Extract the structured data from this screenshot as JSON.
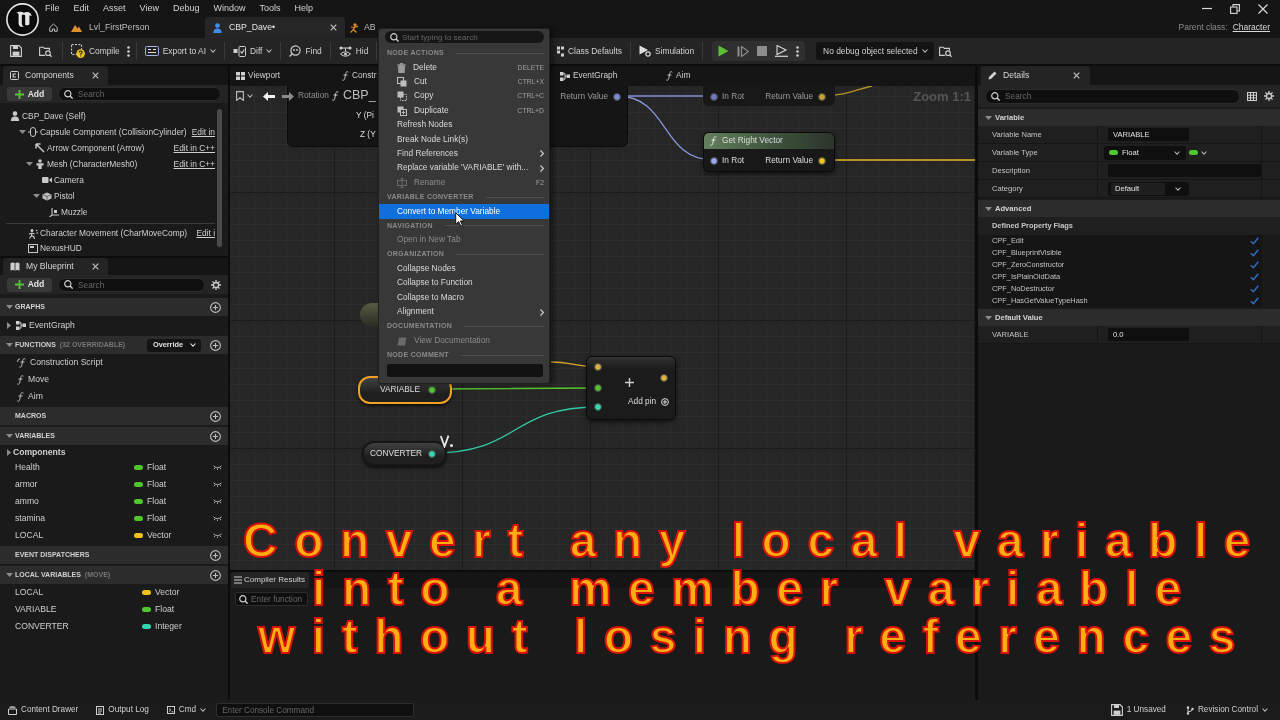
{
  "title_bar": {
    "menu": [
      "File",
      "Edit",
      "Asset",
      "View",
      "Debug",
      "Window",
      "Tools",
      "Help"
    ],
    "tabs": [
      {
        "label": "Lvl_FirstPerson",
        "kind": "level",
        "selected": false
      },
      {
        "label": "CBP_Dave•",
        "kind": "blueprint",
        "selected": true
      },
      {
        "label": "AB",
        "kind": "animation",
        "selected": false
      }
    ],
    "parent_class_label": "Parent class:",
    "parent_class": "Character"
  },
  "toolbar": {
    "items": [
      {
        "kind": "compile",
        "label": "Compile",
        "dropdown": false
      },
      {
        "kind": "export",
        "label": "Export to AI",
        "dropdown": true
      },
      {
        "kind": "diff",
        "label": "Diff",
        "dropdown": true
      },
      {
        "kind": "find",
        "label": "Find",
        "dropdown": false
      },
      {
        "kind": "hide",
        "label": "Hid",
        "dropdown": false
      },
      {
        "kind": "class_defaults",
        "label": "Class Defaults",
        "dropdown": false
      },
      {
        "kind": "simulation",
        "label": "Simulation",
        "dropdown": false
      }
    ],
    "debug_object": "No debug object selected"
  },
  "components_panel": {
    "title": "Components",
    "add": "Add",
    "search_placeholder": "Search",
    "tree": [
      {
        "label": "CBP_Dave (Self)",
        "kind": "self",
        "children": [
          {
            "label": "Capsule Component (CollisionCylinder)",
            "kind": "capsule",
            "edit_link": "Edit in",
            "expanded": true,
            "children": [
              {
                "label": "Arrow Component (Arrow)",
                "kind": "arrow",
                "edit_link": "Edit in C++"
              },
              {
                "label": "Mesh (CharacterMesh0)",
                "kind": "mesh",
                "edit_link": "Edit in C++",
                "expanded": true,
                "children": [
                  {
                    "label": "Camera",
                    "kind": "camera"
                  },
                  {
                    "label": "Pistol",
                    "kind": "static_mesh",
                    "expanded": true,
                    "children": [
                      {
                        "label": "Muzzle",
                        "kind": "scene"
                      }
                    ]
                  }
                ]
              }
            ]
          }
        ]
      }
    ],
    "other_components": [
      {
        "label": "Character Movement (CharMoveComp)",
        "kind": "movement",
        "edit_link": "Edit i"
      },
      {
        "label": "NexusHUD",
        "kind": "widget"
      }
    ]
  },
  "my_blueprint": {
    "title": "My Blueprint",
    "add": "Add",
    "search_placeholder": "Search",
    "sections": [
      {
        "heading": "GRAPHS",
        "expanded": true,
        "items": [
          {
            "label": "EventGraph",
            "kind": "graph",
            "expanded": false
          }
        ]
      },
      {
        "heading": "FUNCTIONS",
        "note": "(32 OVERRIDABLE)",
        "override": "Override",
        "expanded": true,
        "items": [
          {
            "label": "Construction Script",
            "kind": "construction"
          },
          {
            "label": "Move",
            "kind": "function"
          },
          {
            "label": "Aim",
            "kind": "function"
          }
        ]
      },
      {
        "heading": "MACROS"
      },
      {
        "heading": "VARIABLES",
        "expanded": true,
        "items": [
          {
            "label": "Components",
            "kind": "category",
            "expanded": false
          },
          {
            "label": "Health",
            "kind": "variable",
            "type": "Float",
            "color": "#52c62e",
            "public": false
          },
          {
            "label": "armor",
            "kind": "variable",
            "type": "Float",
            "color": "#52c62e",
            "public": false
          },
          {
            "label": "ammo",
            "kind": "variable",
            "type": "Float",
            "color": "#52c62e",
            "public": false
          },
          {
            "label": "stamina",
            "kind": "variable",
            "type": "Float",
            "color": "#52c62e",
            "public": false
          },
          {
            "label": "LOCAL",
            "kind": "variable",
            "type": "Vector",
            "color": "#f2c21b",
            "public": false
          }
        ]
      },
      {
        "heading": "EVENT DISPATCHERS"
      },
      {
        "heading": "LOCAL VARIABLES",
        "note": "(MOVE)",
        "expanded": true,
        "items": [
          {
            "label": "LOCAL",
            "kind": "local",
            "type": "Vector",
            "color": "#f2c21b"
          },
          {
            "label": "VARIABLE",
            "kind": "local",
            "type": "Float",
            "color": "#52c62e"
          },
          {
            "label": "CONVERTER",
            "kind": "local",
            "type": "Integer",
            "color": "#33d6b0"
          }
        ]
      }
    ]
  },
  "editor_tabs": [
    {
      "label": "Viewport",
      "kind": "viewport",
      "selected": false
    },
    {
      "label": "Constr",
      "kind": "function",
      "selected": false
    },
    {
      "label": "EventGraph",
      "kind": "graph",
      "selected": false
    },
    {
      "label": "Aim",
      "kind": "function",
      "selected": false
    }
  ],
  "graph": {
    "breadcrumb": "CBP_",
    "zoom": "Zoom 1:1",
    "nodes": [
      {
        "kind": "partial",
        "labels": [
          "Rotation",
          "Y (Pi",
          "Z (Y"
        ],
        "outputs": [
          {
            "label": "Return Value",
            "color": "#7d8bd6"
          }
        ]
      },
      {
        "kind": "pure",
        "inputs": [
          {
            "label": "In Rot",
            "color": "#6f7bc0"
          }
        ],
        "outputs": [
          {
            "label": "Return Value",
            "color": "#c9a22a"
          }
        ]
      },
      {
        "kind": "function",
        "title": "Get Right Vector",
        "inputs": [
          {
            "label": "In Rot",
            "color": "#9aa8f0"
          }
        ],
        "outputs": [
          {
            "label": "Return Value",
            "color": "#f2c21b"
          }
        ]
      },
      {
        "kind": "stub"
      },
      {
        "kind": "variable",
        "label": "VARIABLE",
        "color": "#52c62e",
        "selected": true
      },
      {
        "kind": "variable",
        "label": "CONVERTER",
        "color": "#33d6b0",
        "selected": false
      },
      {
        "kind": "add_pin",
        "label": "Add pin",
        "inputs": [
          {
            "color": "#d9b23a"
          },
          {
            "color": "#52c62e"
          },
          {
            "color": "#33d6b0"
          }
        ],
        "outputs": [
          {
            "color": "#d9b23a"
          }
        ]
      }
    ]
  },
  "compiler_results": {
    "title": "Compiler Results",
    "search_placeholder": "Enter function"
  },
  "details": {
    "title": "Details",
    "search_placeholder": "Search",
    "sections": [
      {
        "heading": "Variable",
        "expanded": true,
        "rows": [
          {
            "kind": "text",
            "label": "Variable Name",
            "value": "VARIABLE"
          },
          {
            "kind": "type",
            "label": "Variable Type",
            "value": "Float",
            "color": "#52c62e"
          },
          {
            "kind": "long_text",
            "label": "Description"
          },
          {
            "kind": "combo",
            "label": "Category",
            "value": "Default"
          }
        ]
      },
      {
        "heading": "Advanced",
        "expanded": true,
        "group": "Defined Property Flags",
        "flags": [
          {
            "label": "CPF_Edit",
            "checked": true
          },
          {
            "label": "CPF_BlueprintVisible",
            "checked": true
          },
          {
            "label": "CPF_ZeroConstructor",
            "checked": true
          },
          {
            "label": "CPF_IsPlainOldData",
            "checked": true
          },
          {
            "label": "CPF_NoDestructor",
            "checked": true
          },
          {
            "label": "CPF_HasGetValueTypeHash",
            "checked": true
          }
        ]
      },
      {
        "heading": "Default Value",
        "expanded": true,
        "rows": [
          {
            "kind": "text",
            "label": "VARIABLE",
            "value": "0.0"
          }
        ]
      }
    ]
  },
  "context_menu": {
    "search_placeholder": "Start typing to search",
    "sections": [
      {
        "heading": "NODE ACTIONS",
        "items": [
          {
            "label": "Delete",
            "kind": "delete",
            "shortcut": "DELETE",
            "submenu": false,
            "disabled": false,
            "selected": false
          },
          {
            "label": "Cut",
            "kind": "cut",
            "shortcut": "CTRL+X",
            "submenu": false,
            "disabled": false,
            "selected": false
          },
          {
            "label": "Copy",
            "kind": "copy",
            "shortcut": "CTRL+C",
            "submenu": false,
            "disabled": false,
            "selected": false
          },
          {
            "label": "Duplicate",
            "kind": "duplicate",
            "shortcut": "CTRL+D",
            "submenu": false,
            "disabled": false,
            "selected": false
          },
          {
            "label": "Refresh Nodes",
            "kind": "plain",
            "submenu": false,
            "disabled": false,
            "selected": false
          },
          {
            "label": "Break Node Link(s)",
            "kind": "plain",
            "submenu": false,
            "disabled": false,
            "selected": false
          },
          {
            "label": "Find References",
            "kind": "plain",
            "submenu": true,
            "disabled": false,
            "selected": false
          },
          {
            "label": "Replace variable 'VARIABLE' with...",
            "kind": "plain",
            "submenu": true,
            "disabled": false,
            "selected": false
          },
          {
            "label": "Rename",
            "kind": "rename",
            "shortcut": "F2",
            "submenu": false,
            "disabled": true,
            "selected": false
          }
        ]
      },
      {
        "heading": "VARIABLE CONVERTER",
        "items": [
          {
            "label": "Convert to Member Variable",
            "kind": "plain",
            "submenu": false,
            "disabled": false,
            "selected": true
          }
        ]
      },
      {
        "heading": "NAVIGATION",
        "items": [
          {
            "label": "Open in New Tab",
            "kind": "plain",
            "submenu": false,
            "disabled": true,
            "selected": false
          }
        ]
      },
      {
        "heading": "ORGANIZATION",
        "items": [
          {
            "label": "Collapse Nodes",
            "kind": "plain",
            "submenu": false,
            "disabled": false,
            "selected": false
          },
          {
            "label": "Collapse to Function",
            "kind": "plain",
            "submenu": false,
            "disabled": false,
            "selected": false
          },
          {
            "label": "Collapse to Macro",
            "kind": "plain",
            "submenu": false,
            "disabled": false,
            "selected": false
          },
          {
            "label": "Alignment",
            "kind": "plain",
            "submenu": true,
            "disabled": false,
            "selected": false
          }
        ]
      },
      {
        "heading": "DOCUMENTATION",
        "items": [
          {
            "label": "View Documentation",
            "kind": "docs",
            "submenu": false,
            "disabled": true,
            "selected": false
          }
        ]
      },
      {
        "heading": "NODE COMMENT",
        "comment_field": true
      }
    ]
  },
  "status_bar": {
    "left_items": [
      {
        "kind": "drawer",
        "label": "Content Drawer",
        "dropdown": false
      },
      {
        "kind": "log",
        "label": "Output Log",
        "dropdown": false
      },
      {
        "kind": "cmd",
        "label": "Cmd",
        "dropdown": true
      }
    ],
    "console_placeholder": "Enter Console Command",
    "right_items": [
      {
        "kind": "unsaved",
        "label": "1 Unsaved",
        "dropdown": false
      },
      {
        "kind": "revision",
        "label": "Revision Control",
        "dropdown": true
      }
    ]
  },
  "caption": {
    "lines": [
      "Convert any local variable",
      "into a member variable",
      "without losing references"
    ]
  }
}
